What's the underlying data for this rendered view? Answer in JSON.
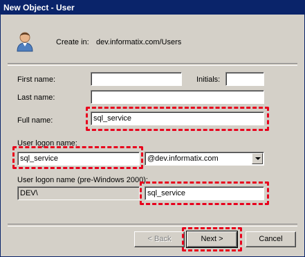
{
  "window": {
    "title": "New Object - User"
  },
  "header": {
    "create_in_label": "Create in:",
    "create_in_value": "dev.informatix.com/Users",
    "icon": "user-icon"
  },
  "form": {
    "first_name_label": "First name:",
    "first_name_value": "",
    "initials_label": "Initials:",
    "initials_value": "",
    "last_name_label": "Last name:",
    "last_name_value": "",
    "full_name_label": "Full name:",
    "full_name_value": "sql_service",
    "logon_name_label": "User logon name:",
    "logon_name_value": "sql_service",
    "domain_selected": "@dev.informatix.com",
    "pre2000_label": "User logon name (pre-Windows 2000):",
    "pre2000_domain": "DEV\\",
    "pre2000_value": "sql_service"
  },
  "buttons": {
    "back": "< Back",
    "next": "Next >",
    "cancel": "Cancel"
  },
  "colors": {
    "highlight": "#e8001c",
    "titlebar": "#0a246a"
  }
}
